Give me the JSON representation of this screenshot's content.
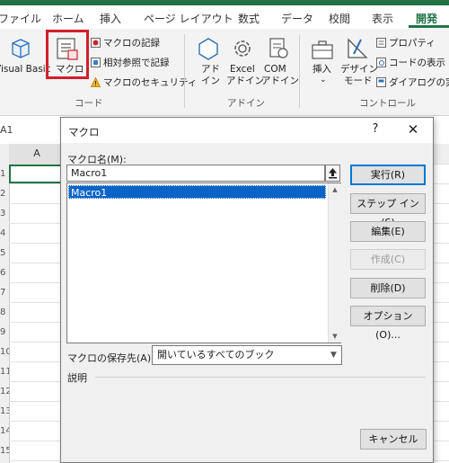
{
  "ribbon": {
    "tabs": [
      "ファイル",
      "ホーム",
      "挿入",
      "ページ レイアウト",
      "数式",
      "データ",
      "校閲",
      "表示",
      "開発"
    ],
    "active_tab": "開発",
    "code_group": {
      "visual_basic_label": "Visual Basic",
      "macro_label": "マクロ",
      "record_macro": "マクロの記録",
      "relative_ref": "相対参照で記録",
      "macro_security": "マクロのセキュリティ",
      "group_label": "コード"
    },
    "addin_group": {
      "addin_label_1": "アド",
      "addin_label_2": "イン",
      "excel_addin_1": "Excel",
      "excel_addin_2": "アドイン",
      "com_addin_1": "COM",
      "com_addin_2": "アドイン",
      "group_label": "アドイン"
    },
    "control_group": {
      "insert_label": "挿入",
      "design_mode_1": "デザイン",
      "design_mode_2": "モード",
      "properties": "プロパティ",
      "view_code": "コードの表示",
      "run_dialog": "ダイアログの実行",
      "group_label": "コントロール"
    }
  },
  "sheet": {
    "name_box": "A1",
    "column_header": "A",
    "row_numbers": [
      "1",
      "2",
      "3",
      "4",
      "5",
      "6",
      "7",
      "8",
      "9",
      "10",
      "11",
      "12",
      "13",
      "14",
      "15"
    ]
  },
  "dialog": {
    "title": "マクロ",
    "help_symbol": "?",
    "close_symbol": "✕",
    "macro_name_label": "マクロ名(M):",
    "macro_name_value": "Macro1",
    "macro_list": [
      "Macro1"
    ],
    "buttons": {
      "run": "実行(R)",
      "step_into": "ステップ イン(S)",
      "edit": "編集(E)",
      "create": "作成(C)",
      "delete": "削除(D)",
      "options": "オプション(O)...",
      "cancel": "キャンセル"
    },
    "save_location_label": "マクロの保存先(A):",
    "save_location_value": "開いているすべてのブック",
    "description_label": "説明"
  },
  "colors": {
    "excel_green": "#217346",
    "selection_blue": "#0a64c8",
    "highlight_red": "#d0202a",
    "default_button_border": "#0078d7"
  }
}
